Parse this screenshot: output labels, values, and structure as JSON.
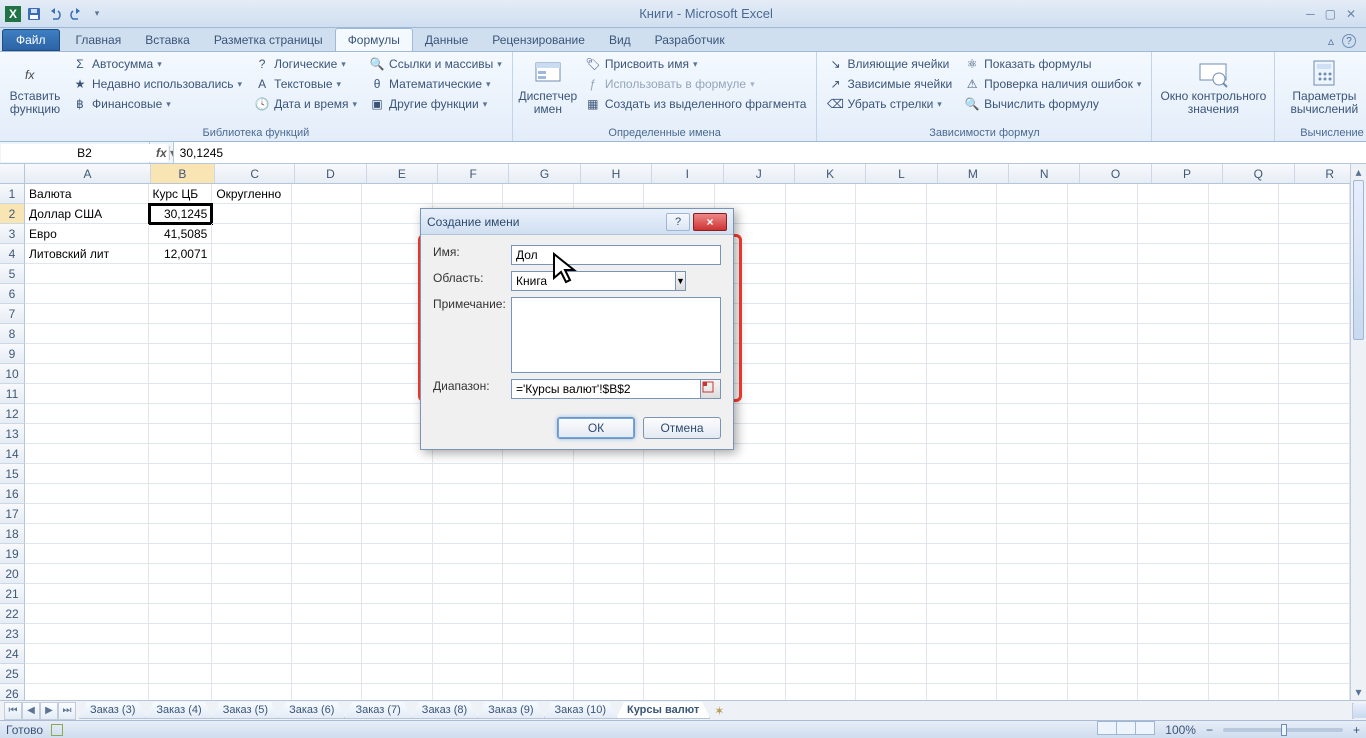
{
  "app": {
    "title": "Книги - Microsoft Excel"
  },
  "tabs": {
    "file": "Файл",
    "items": [
      "Главная",
      "Вставка",
      "Разметка страницы",
      "Формулы",
      "Данные",
      "Рецензирование",
      "Вид",
      "Разработчик"
    ],
    "activeIndex": 3
  },
  "ribbon": {
    "g1": {
      "insertFn": "Вставить функцию",
      "autosum": "Автосумма",
      "recent": "Недавно использовались",
      "financial": "Финансовые",
      "logical": "Логические",
      "text": "Текстовые",
      "datetime": "Дата и время",
      "lookup": "Ссылки и массивы",
      "math": "Математические",
      "more": "Другие функции",
      "label": "Библиотека функций"
    },
    "g2": {
      "nameMgr": "Диспетчер имен",
      "define": "Присвоить имя",
      "useIn": "Использовать в формуле",
      "createFrom": "Создать из выделенного фрагмента",
      "label": "Определенные имена"
    },
    "g3": {
      "tracePrec": "Влияющие ячейки",
      "traceDep": "Зависимые ячейки",
      "removeArr": "Убрать стрелки",
      "showF": "Показать формулы",
      "errChk": "Проверка наличия ошибок",
      "evalF": "Вычислить формулу",
      "label": "Зависимости формул"
    },
    "g4": {
      "watch": "Окно контрольного значения"
    },
    "g5": {
      "calcOpt": "Параметры вычислений",
      "label": "Вычисление"
    }
  },
  "formulaBar": {
    "nameBox": "B2",
    "formula": "30,1245"
  },
  "columns": [
    "A",
    "B",
    "C",
    "D",
    "E",
    "F",
    "G",
    "H",
    "I",
    "J",
    "K",
    "L",
    "M",
    "N",
    "O",
    "P",
    "Q",
    "R"
  ],
  "gridData": {
    "r1": {
      "A": "Валюта",
      "B": "Курс ЦБ",
      "C": "Округленно"
    },
    "r2": {
      "A": "Доллар США",
      "B": "30,1245"
    },
    "r3": {
      "A": "Евро",
      "B": "41,5085"
    },
    "r4": {
      "A": "Литовский лит",
      "B": "12,0071"
    }
  },
  "sheets": {
    "nav": [
      "⏮",
      "◀",
      "▶",
      "⏭"
    ],
    "tabs": [
      "Заказ (3)",
      "Заказ (4)",
      "Заказ (5)",
      "Заказ (6)",
      "Заказ (7)",
      "Заказ (8)",
      "Заказ (9)",
      "Заказ (10)",
      "Курсы валют"
    ],
    "activeIndex": 8
  },
  "status": {
    "ready": "Готово",
    "zoom": "100%"
  },
  "dialog": {
    "title": "Создание имени",
    "nameLbl": "Имя:",
    "nameVal": "Дол",
    "scopeLbl": "Область:",
    "scopeVal": "Книга",
    "commentLbl": "Примечание:",
    "rangeLbl": "Диапазон:",
    "rangeVal": "='Курсы валют'!$B$2",
    "ok": "ОК",
    "cancel": "Отмена",
    "help": "?",
    "close": "×"
  }
}
